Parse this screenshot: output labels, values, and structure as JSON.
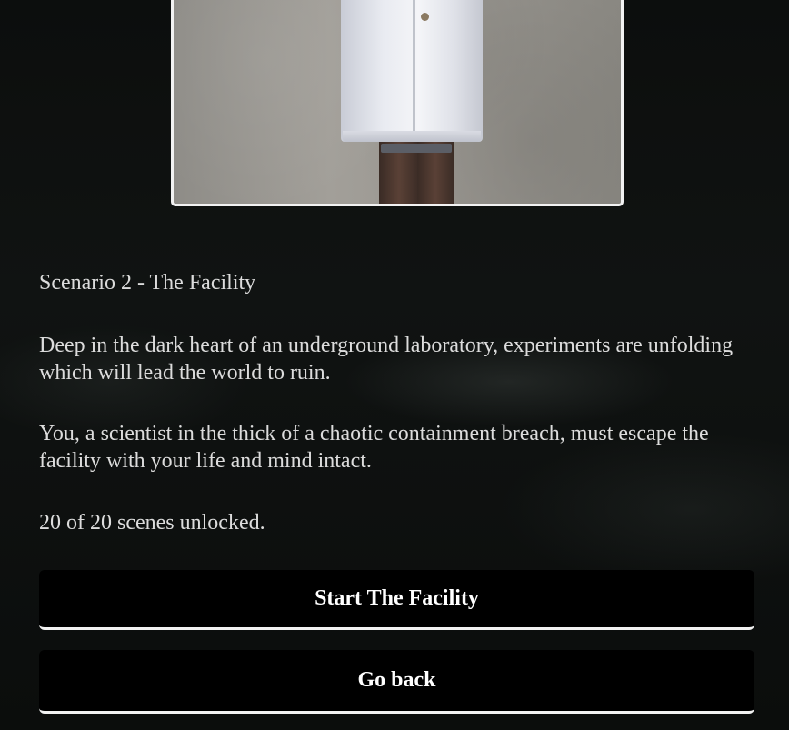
{
  "scenario": {
    "title": "Scenario 2 - The Facility",
    "description_1": "Deep in the dark heart of an underground laboratory, experiments are unfolding which will lead the world to ruin.",
    "description_2": "You, a scientist in the thick of a chaotic containment breach, must escape the facility with your life and mind intact.",
    "scenes_unlocked_text": "20 of 20 scenes unlocked.",
    "scenes_unlocked": 20,
    "scenes_total": 20
  },
  "actions": {
    "start_label": "Start The Facility",
    "back_label": "Go back"
  },
  "colors": {
    "background": "#0a0c0b",
    "text": "#dcdcdc",
    "button_bg": "#000000",
    "button_text": "#ffffff",
    "button_underline": "#f2f2f2"
  }
}
